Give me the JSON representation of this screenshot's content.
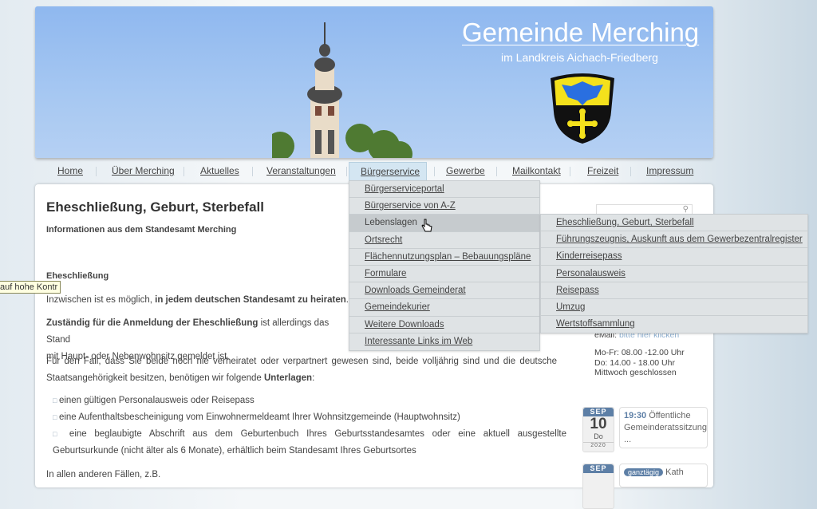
{
  "header": {
    "title": "Gemeinde Merching",
    "subtitle": "im Landkreis Aichach-Friedberg"
  },
  "nav": [
    "Home",
    "Über Merching",
    "Aktuelles",
    "Veranstaltungen",
    "Bürgerservice",
    "Gewerbe",
    "Mailkontakt",
    "Freizeit",
    "Impressum"
  ],
  "dropdown": [
    "Bürgerserviceportal",
    "Bürgerservice von A-Z",
    "Lebenslagen",
    "Ortsrecht",
    "Flächennutzungsplan – Bebauungspläne",
    "Formulare",
    "Downloads Gemeinderat",
    "Gemeindekurier",
    "Weitere Downloads",
    "Interessante Links im Web"
  ],
  "submenu": [
    "Eheschließung, Geburt, Sterbefall",
    "Führungszeugnis, Auskunft aus dem Gewerbezentralregister",
    "Kinderreisepass",
    "Personalausweis",
    "Reisepass",
    "Umzug",
    "Wertstoffsammlung"
  ],
  "tooltip": "auf hohe Kontr",
  "main": {
    "title": "Eheschließung, Geburt, Sterbefall",
    "intro": "Informationen aus dem Standesamt Merching",
    "section": "Eheschließung",
    "p1a": "Inzwischen ist es möglich, ",
    "p1b": "in jedem deutschen Standesamt zu heiraten",
    "p2a": "Zuständig für die Anmeldung der Eheschließung",
    "p2b": " ist allerdings das Stand",
    "p2c": "mit Haupt- oder Nebenwohnsitz gemeldet ist.",
    "p3": "Für den Fall, dass Sie beide noch nie verheiratet oder verpartnert gewesen sind, beide volljährig sind und die deutsche Staatsangehörigkeit besitzen, benötigen wir folgende ",
    "p3b": "Unterlagen",
    "list": [
      "einen gültigen Personalausweis oder Reisepass",
      "eine Aufenthaltsbescheinigung vom Einwohnermeldeamt Ihrer Wohnsitzgemeinde (Hauptwohnsitz)",
      "eine beglaubigte Abschrift aus dem Geburtenbuch Ihres Geburtsstandesamtes oder eine aktuell ausgestellte Geburtsurkunde (nicht älter als 6 Monate), erhältlich beim Standesamt Ihres Geburtsortes"
    ],
    "p4": "In allen anderen Fällen, z.B."
  },
  "sidebar": {
    "email_label": "eMail: ",
    "email_link": "bitte hier klicken",
    "hours": [
      "Mo-Fr: 08.00 -12.00 Uhr",
      "Do: 14.00 - 18.00 Uhr",
      "Mittwoch geschlossen"
    ],
    "events": [
      {
        "month": "SEP",
        "day": "10",
        "weekday": "Do",
        "year": "2020",
        "time": "19:30",
        "text": " Öffentliche Gemeinderatssitzung ..."
      },
      {
        "month": "SEP",
        "badge": "ganztägig",
        "text": " Kath"
      }
    ]
  }
}
